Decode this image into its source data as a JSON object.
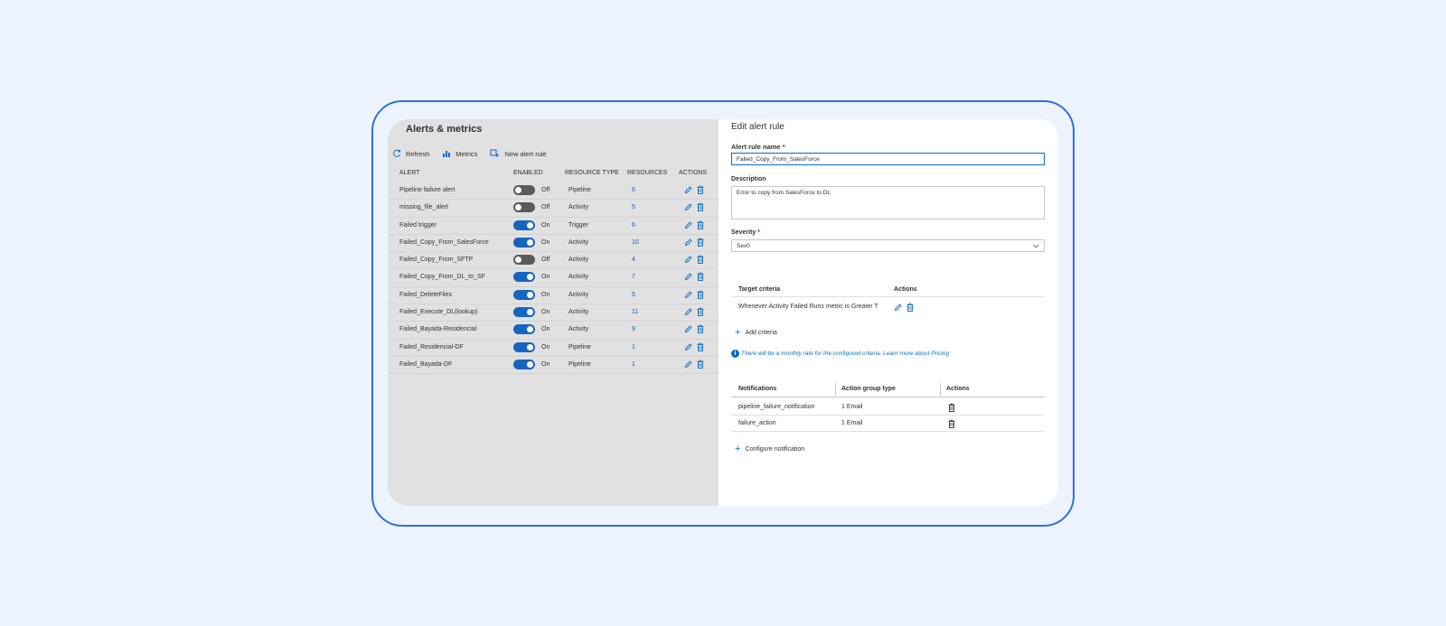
{
  "alerts_panel": {
    "title": "Alerts & metrics",
    "toolbar": {
      "refresh_label": "Refresh",
      "metrics_label": "Metrics",
      "new_rule_label": "New alert rule"
    },
    "columns": [
      "ALERT",
      "ENABLED",
      "RESOURCE TYPE",
      "RESOURCES",
      "ACTIONS"
    ],
    "rows": [
      {
        "alert": "Pipeline failure alert",
        "enabled": false,
        "state": "Off",
        "type": "Pipeline",
        "resources": "6"
      },
      {
        "alert": "missing_file_alert",
        "enabled": false,
        "state": "Off",
        "type": "Activity",
        "resources": "5"
      },
      {
        "alert": "Failed trigger",
        "enabled": true,
        "state": "On",
        "type": "Trigger",
        "resources": "6"
      },
      {
        "alert": "Failed_Copy_From_SalesForce",
        "enabled": true,
        "state": "On",
        "type": "Activity",
        "resources": "10"
      },
      {
        "alert": "Failed_Copy_From_SFTP",
        "enabled": false,
        "state": "Off",
        "type": "Activity",
        "resources": "4"
      },
      {
        "alert": "Failed_Copy_From_DL_to_SF",
        "enabled": true,
        "state": "On",
        "type": "Activity",
        "resources": "7"
      },
      {
        "alert": "Failed_DeleteFiles",
        "enabled": true,
        "state": "On",
        "type": "Activity",
        "resources": "5"
      },
      {
        "alert": "Failed_Execute_DL(lookup)",
        "enabled": true,
        "state": "On",
        "type": "Activity",
        "resources": "11"
      },
      {
        "alert": "Failed_Bayada-Residencial",
        "enabled": true,
        "state": "On",
        "type": "Activity",
        "resources": "9"
      },
      {
        "alert": "Failed_Residencial-DF",
        "enabled": true,
        "state": "On",
        "type": "Pipeline",
        "resources": "1"
      },
      {
        "alert": "Failed_Bayada-DF",
        "enabled": true,
        "state": "On",
        "type": "Pipeline",
        "resources": "1"
      }
    ]
  },
  "edit_panel": {
    "title": "Edit alert rule",
    "rule_name_label": "Alert rule name",
    "required_mark": "*",
    "rule_name_value": "Failed_Copy_From_SalesForce",
    "description_label": "Description",
    "description_value": "Error to copy from SalesForce to DL",
    "severity_label": "Severity",
    "severity_value": "Sev0",
    "target_header": "Target criteria",
    "target_actions_header": "Actions",
    "target_criteria_text": "Whenever Activity Failed Runs metric is Greater T",
    "add_criteria_label": "Add criteria",
    "info_text": "There will be a monthly rate for the configured criteria. Learn more about Pricing",
    "notif_columns": [
      "Notifications",
      "Action group type",
      "Actions"
    ],
    "notifications": [
      {
        "name": "pipeline_failure_notification",
        "type": "1 Email"
      },
      {
        "name": "failure_action",
        "type": "1 Email"
      }
    ],
    "configure_notification_label": "Configure notification"
  },
  "colors": {
    "accent": "#0f6cbd",
    "toggle_on": "#1565c0",
    "toggle_off": "#5a5a5a",
    "frame_border": "#2b6fe6",
    "page_background": "#eef4ff"
  },
  "icons": [
    "refresh-icon",
    "metrics-icon",
    "new-alert-icon",
    "edit-icon",
    "delete-icon",
    "plus-icon",
    "info-icon",
    "chevron-down-icon"
  ]
}
